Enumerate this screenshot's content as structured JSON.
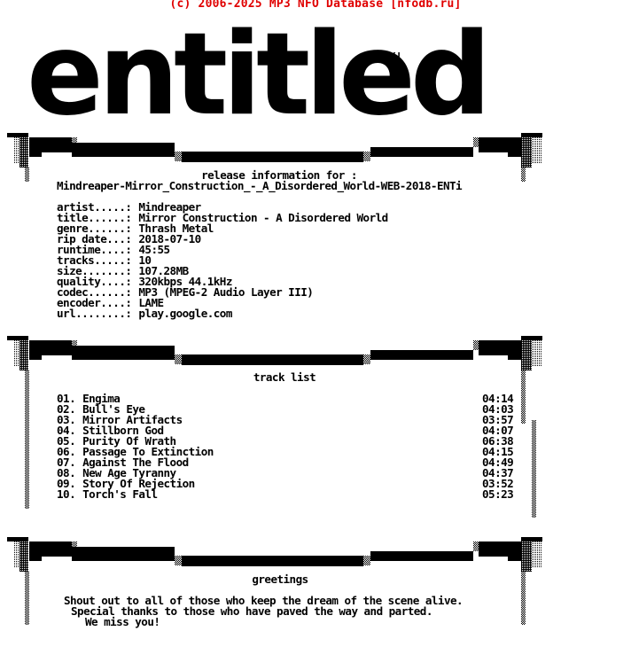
{
  "header": {
    "copyright": "(c) 2006-2025 MP3 NFO Database [nfodb.ru]",
    "color": "#e00000"
  },
  "logo": {
    "text": "entitled",
    "tag": "hX!"
  },
  "release": {
    "heading": "release information for :",
    "name": "Mindreaper-Mirror_Construction_-_A_Disordered_World-WEB-2018-ENTi",
    "fields": [
      {
        "label": "artist.....:",
        "value": "Mindreaper"
      },
      {
        "label": "title......:",
        "value": "Mirror Construction - A Disordered World"
      },
      {
        "label": "genre......:",
        "value": "Thrash Metal"
      },
      {
        "label": "rip date...:",
        "value": "2018-07-10"
      },
      {
        "label": "runtime....:",
        "value": "45:55"
      },
      {
        "label": "tracks.....:",
        "value": "10"
      },
      {
        "label": "size.......:",
        "value": "107.28MB"
      },
      {
        "label": "quality....:",
        "value": "320kbps 44.1kHz"
      },
      {
        "label": "codec......:",
        "value": "MP3 (MPEG-2 Audio Layer III)"
      },
      {
        "label": "encoder....:",
        "value": "LAME"
      },
      {
        "label": "url........:",
        "value": "play.google.com"
      }
    ]
  },
  "tracklist": {
    "heading": "track list",
    "tracks": [
      {
        "num": "01.",
        "title": "Engima",
        "length": "04:14"
      },
      {
        "num": "02.",
        "title": "Bull's Eye",
        "length": "04:03"
      },
      {
        "num": "03.",
        "title": "Mirror Artifacts",
        "length": "03:57"
      },
      {
        "num": "04.",
        "title": "Stillborn God",
        "length": "04:07"
      },
      {
        "num": "05.",
        "title": "Purity Of Wrath",
        "length": "06:38"
      },
      {
        "num": "06.",
        "title": "Passage To Extinction",
        "length": "04:15"
      },
      {
        "num": "07.",
        "title": "Against The Flood",
        "length": "04:49"
      },
      {
        "num": "08.",
        "title": "New Age Tyranny",
        "length": "04:37"
      },
      {
        "num": "09.",
        "title": "Story Of Rejection",
        "length": "03:52"
      },
      {
        "num": "10.",
        "title": "Torch's Fall",
        "length": "05:23"
      }
    ]
  },
  "greetings": {
    "heading": "greetings",
    "lines": [
      "Shout out to all of those who keep the dream of the scene alive.",
      "Special thanks to those who have paved the way and parted.",
      "We miss you!"
    ]
  }
}
